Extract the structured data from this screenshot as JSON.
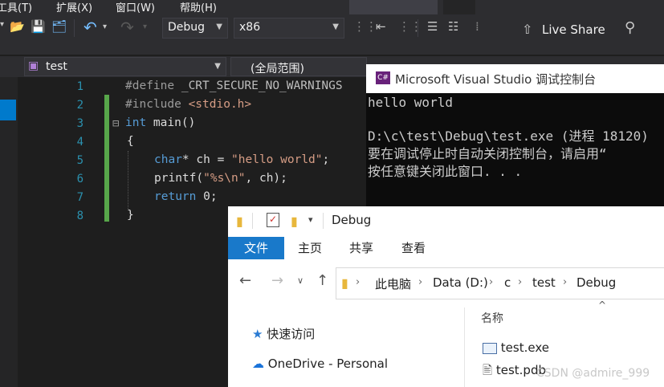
{
  "menu": {
    "tools": "工具(T)",
    "extensions": "扩展(X)",
    "window": "窗口(W)",
    "help": "帮助(H)"
  },
  "toolbar": {
    "configuration": "Debug",
    "platform": "x86",
    "live_share": "Live Share"
  },
  "editor_nav": {
    "file": "test",
    "scope": "(全局范围)"
  },
  "editor": {
    "line_numbers": [
      "1",
      "2",
      "3",
      "4",
      "5",
      "6",
      "7",
      "8"
    ],
    "line1": {
      "directive": "#define",
      "macro": " _CRT_SECURE_NO_WARNINGS"
    },
    "line2": {
      "directive": "#include",
      "header": " <stdio.h>"
    },
    "line3": {
      "type": "int",
      "rest": " main()"
    },
    "line4": "{",
    "line5": {
      "type": "char",
      "mid": "* ch = ",
      "string": "\"hello world\"",
      "end": ";"
    },
    "line6": {
      "func": "printf(",
      "string": "\"%s\\n\"",
      "end": ", ch);"
    },
    "line7": {
      "keyword": "return",
      "end": " 0;"
    },
    "line8": "}",
    "collapse_glyph": "⊟"
  },
  "console": {
    "title": "Microsoft Visual Studio 调试控制台",
    "icon_text": "C#",
    "lines": [
      "hello world",
      "",
      "D:\\c\\test\\Debug\\test.exe (进程 18120)",
      "要在调试停止时自动关闭控制台，请启用“",
      "按任意键关闭此窗口. . ."
    ]
  },
  "explorer": {
    "title": "Debug",
    "ribbon_tabs": [
      "文件",
      "主页",
      "共享",
      "查看"
    ],
    "breadcrumb": [
      "此电脑",
      "Data (D:)",
      "c",
      "test",
      "Debug"
    ],
    "nav_items": [
      "快速访问",
      "OneDrive - Personal"
    ],
    "column_header": "名称",
    "files": [
      "test.exe",
      "test.pdb"
    ]
  },
  "watermark": "CSDN @admire_999",
  "colors": {
    "accent": "#007acc",
    "ribbon_file_tab": "#1979ca",
    "gutter_change": "#57a64a"
  }
}
